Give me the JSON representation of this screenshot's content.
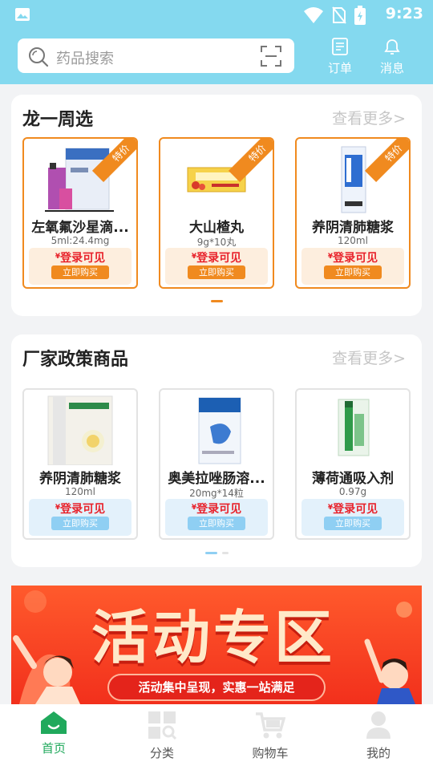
{
  "status_bar": {
    "time": "9:23"
  },
  "search": {
    "placeholder": "药品搜索"
  },
  "header": {
    "orders_label": "订单",
    "messages_label": "消息"
  },
  "section_weekly": {
    "title": "龙一周选",
    "more": "查看更多>",
    "products": [
      {
        "name": "左氧氟沙星滴...",
        "spec": "5ml:24.4mg",
        "price": "登录可见",
        "buy": "立即购买",
        "badge": "特价"
      },
      {
        "name": "大山楂丸",
        "spec": "9g*10丸",
        "price": "登录可见",
        "buy": "立即购买",
        "badge": "特价"
      },
      {
        "name": "养阴清肺糖浆",
        "spec": "120ml",
        "price": "登录可见",
        "buy": "立即购买",
        "badge": "特价"
      }
    ]
  },
  "section_factory": {
    "title": "厂家政策商品",
    "more": "查看更多>",
    "products": [
      {
        "name": "养阴清肺糖浆",
        "spec": "120ml",
        "price": "登录可见",
        "buy": "立即购买"
      },
      {
        "name": "奥美拉唑肠溶...",
        "spec": "20mg*14粒",
        "price": "登录可见",
        "buy": "立即购买"
      },
      {
        "name": "薄荷通吸入剂",
        "spec": "0.97g",
        "price": "登录可见",
        "buy": "立即购买"
      }
    ]
  },
  "banner": {
    "title": "活动专区",
    "subtitle": "活动集中呈现，实惠一站满足"
  },
  "bottom_nav": [
    {
      "label": "首页",
      "icon": "home-icon",
      "active": true
    },
    {
      "label": "分类",
      "icon": "category-icon",
      "active": false
    },
    {
      "label": "购物车",
      "icon": "cart-icon",
      "active": false
    },
    {
      "label": "我的",
      "icon": "profile-icon",
      "active": false
    }
  ],
  "colors": {
    "header": "#84d9ef",
    "accent_orange": "#f08a1f",
    "price_red": "#e8222b",
    "nav_active": "#20a95c"
  }
}
